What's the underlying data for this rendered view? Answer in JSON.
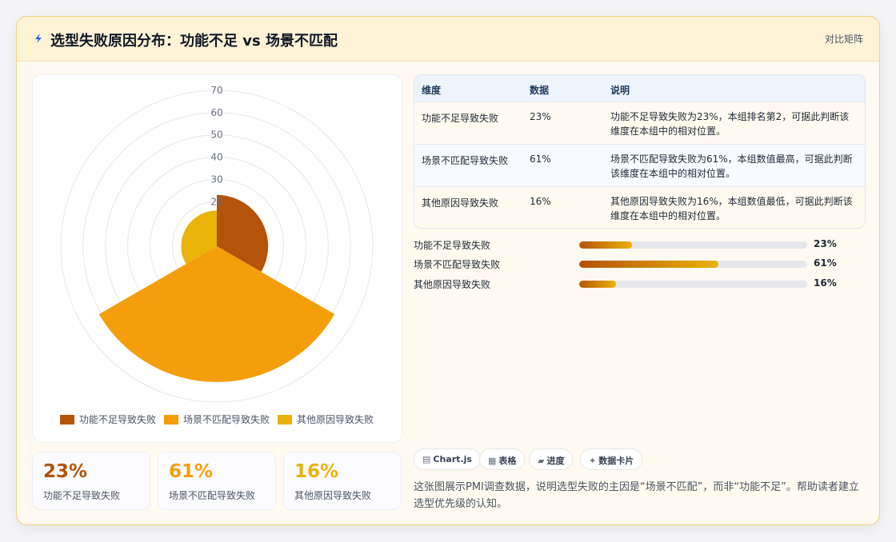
{
  "header": {
    "title": "选型失败原因分布：功能不足 vs 场景不匹配",
    "action_label": "对比矩阵"
  },
  "colors": {
    "series": [
      "#b45309",
      "#f59e0b",
      "#eab308"
    ],
    "accent": "#b45309"
  },
  "chart_data": {
    "type": "polarArea",
    "categories": [
      "功能不足导致失败",
      "场景不匹配导致失败",
      "其他原因导致失败"
    ],
    "values": [
      23,
      61,
      16
    ],
    "radial_ticks": [
      "20",
      "30",
      "40",
      "50",
      "60",
      "70"
    ],
    "radial_range": [
      0,
      70
    ],
    "grid": true,
    "legend_position": "bottom"
  },
  "stats": [
    {
      "value": "23%",
      "label": "功能不足导致失败"
    },
    {
      "value": "61%",
      "label": "场景不匹配导致失败"
    },
    {
      "value": "16%",
      "label": "其他原因导致失败"
    }
  ],
  "table": {
    "headers": [
      "维度",
      "数据",
      "说明"
    ],
    "rows": [
      {
        "dim": "功能不足导致失败",
        "val": "23%",
        "note": "功能不足导致失败为23%，本组排名第2，可据此判断该维度在本组中的相对位置。"
      },
      {
        "dim": "场景不匹配导致失败",
        "val": "61%",
        "note": "场景不匹配导致失败为61%，本组数值最高，可据此判断该维度在本组中的相对位置。"
      },
      {
        "dim": "其他原因导致失败",
        "val": "16%",
        "note": "其他原因导致失败为16%，本组数值最低，可据此判断该维度在本组中的相对位置。"
      }
    ]
  },
  "progress": [
    {
      "label": "功能不足导致失败",
      "value": "23%",
      "fraction": 0.23
    },
    {
      "label": "场景不匹配导致失败",
      "value": "61%",
      "fraction": 0.61
    },
    {
      "label": "其他原因导致失败",
      "value": "16%",
      "fraction": 0.16
    }
  ],
  "tags": [
    {
      "icon": "chart-icon",
      "label": "Chart.js"
    },
    {
      "icon": "table-icon",
      "label": "表格"
    },
    {
      "icon": "progress-icon",
      "label": "进度"
    },
    {
      "icon": "card-icon",
      "label": "数据卡片"
    }
  ],
  "summary": "这张图展示PMI调查数据，说明选型失败的主因是“场景不匹配”，而非“功能不足”。帮助读者建立选型优先级的认知。"
}
